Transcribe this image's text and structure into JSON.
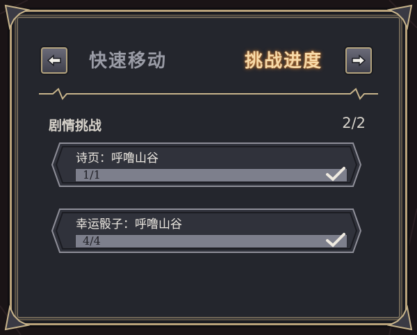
{
  "header": {
    "left_tab": "快速移动",
    "right_tab": "挑战进度",
    "prev_icon": "arrow-left-icon",
    "next_icon": "arrow-right-icon"
  },
  "section": {
    "title": "剧情挑战",
    "count": "2/2"
  },
  "challenges": [
    {
      "title": "诗页：呼噜山谷",
      "progress_text": "1/1",
      "progress": 1.0,
      "completed": true
    },
    {
      "title": "幸运骰子：呼噜山谷",
      "progress_text": "4/4",
      "progress": 1.0,
      "completed": true
    }
  ],
  "colors": {
    "active_tab": "#f6d9a8",
    "inactive_tab": "#9a9ca6",
    "frame_gold": "#b9a27a",
    "panel_bg": "#24262d",
    "bar_fill": "#7d7f8c"
  }
}
